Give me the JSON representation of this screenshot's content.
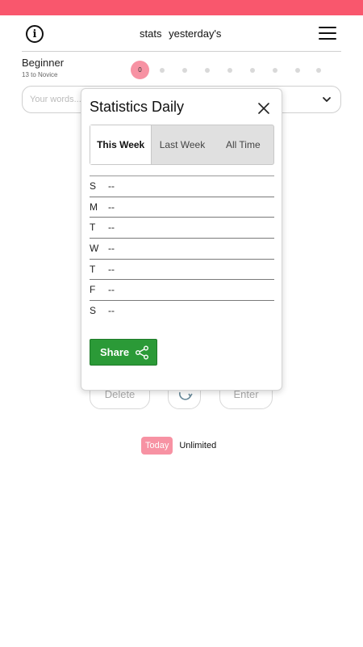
{
  "header": {
    "info_glyph": "i",
    "nav_stats": "stats",
    "nav_yesterday": "yesterday's"
  },
  "level": {
    "name": "Beginner",
    "next": "13 to Novice",
    "current_score": "0"
  },
  "words_input": {
    "placeholder": "Your words..."
  },
  "background_buttons": {
    "delete": "Delete",
    "enter": "Enter"
  },
  "mode": {
    "today": "Today",
    "unlimited": "Unlimited"
  },
  "modal": {
    "title": "Statistics Daily",
    "tabs": [
      {
        "label": "This Week",
        "active": true
      },
      {
        "label": "Last Week",
        "active": false
      },
      {
        "label": "All Time",
        "active": false
      }
    ],
    "week": [
      {
        "day": "S",
        "value": "--"
      },
      {
        "day": "M",
        "value": "--"
      },
      {
        "day": "T",
        "value": "--"
      },
      {
        "day": "W",
        "value": "--"
      },
      {
        "day": "T",
        "value": "--"
      },
      {
        "day": "F",
        "value": "--"
      },
      {
        "day": "S",
        "value": "--"
      }
    ],
    "share_label": "Share"
  },
  "colors": {
    "brand": "#f9576d",
    "badge": "#f792a3",
    "share": "#2b9a37"
  }
}
